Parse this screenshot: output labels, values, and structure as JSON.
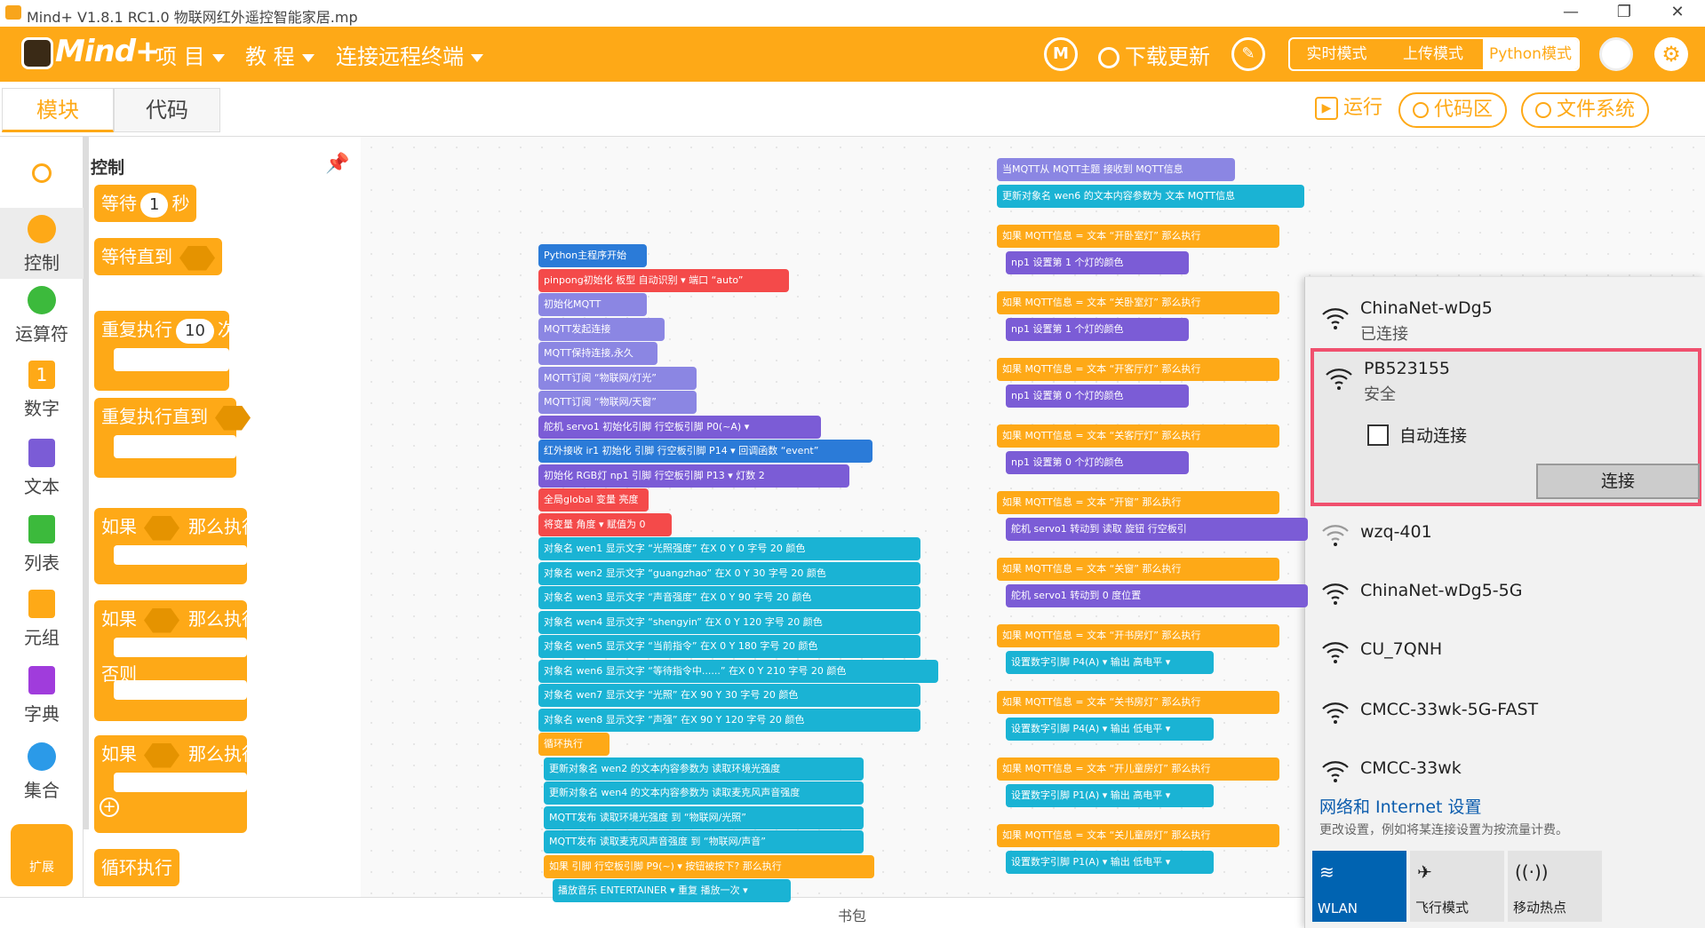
{
  "window": {
    "title": "Mind+ V1.8.1 RC1.0   物联网红外遥控智能家居.mp",
    "min": "—",
    "max": "❐",
    "close": "✕"
  },
  "menu": {
    "logo": "Mind+",
    "items": [
      "项 目",
      "教 程",
      "连接远程终端"
    ],
    "download": "下载更新",
    "modes": [
      "实时模式",
      "上传模式",
      "Python模式"
    ]
  },
  "tabs": {
    "blocks": "模块",
    "code": "代码"
  },
  "actions": {
    "run": "运行",
    "code_area": "代码区",
    "file_system": "文件系统"
  },
  "categories": [
    "控制",
    "运算符",
    "数字",
    "文本",
    "列表",
    "元组",
    "字典",
    "集合"
  ],
  "extension": "扩展",
  "palette": {
    "title": "控制",
    "wait": "等待",
    "wait_val": "1",
    "wait_unit": "秒",
    "wait_until": "等待直到",
    "repeat": "重复执行",
    "repeat_val": "10",
    "repeat_unit": "次",
    "repeat_until": "重复执行直到",
    "if": "如果",
    "then": "那么执行",
    "else": "否则",
    "forever": "循环执行"
  },
  "code": {
    "main": [
      "Python主程序开始",
      "pinpong初始化 板型 自动识别 ▾ 端口 “auto”",
      "初始化MQTT",
      "MQTT发起连接",
      "MQTT保持连接,永久",
      "MQTT订阅 “物联网/灯光”",
      "MQTT订阅 “物联网/天窗”",
      "舵机 servo1 初始化引脚 行空板引脚 P0(~A) ▾",
      "红外接收 ir1 初始化 引脚 行空板引脚 P14 ▾ 回调函数 “event”",
      "初始化 RGB灯 np1 引脚 行空板引脚 P13 ▾ 灯数 2",
      "全局global 变量 亮度",
      "将变量 角度 ▾ 赋值为 0",
      "对象名 wen1 显示文字 “光照强度” 在X 0 Y 0 字号 20 颜色",
      "对象名 wen2 显示文字 “guangzhao” 在X 0 Y 30 字号 20 颜色",
      "对象名 wen3 显示文字 “声音强度” 在X 0 Y 90 字号 20 颜色",
      "对象名 wen4 显示文字 “shengyin” 在X 0 Y 120 字号 20 颜色",
      "对象名 wen5 显示文字 “当前指令” 在X 0 Y 180 字号 20 颜色",
      "对象名 wen6 显示文字 “等待指令中......” 在X 0 Y 210 字号 20 颜色",
      "对象名 wen7 显示文字 “光照” 在X 90 Y 30 字号 20 颜色",
      "对象名 wen8 显示文字 “声强” 在X 90 Y 120 字号 20 颜色",
      "循环执行",
      "更新对象名 wen2 的文本内容参数为 读取环境光强度",
      "更新对象名 wen4 的文本内容参数为 读取麦克风声音强度",
      "MQTT发布 读取环境光强度 到 “物联网/光照”",
      "MQTT发布 读取麦克风声音强度 到 “物联网/声音”",
      "如果 引脚 行空板引脚 P9(~) ▾ 按钮被按下? 那么执行",
      "播放音乐 ENTERTAINER ▾ 重复 播放一次 ▾"
    ],
    "mqtt": [
      "当MQTT从 MQTT主题 接收到 MQTT信息",
      "更新对象名 wen6 的文本内容参数为 文本 MQTT信息",
      "如果 MQTT信息 = 文本 “开卧室灯” 那么执行",
      "np1 设置第 1 个灯的颜色",
      "如果 MQTT信息 = 文本 “关卧室灯” 那么执行",
      "np1 设置第 1 个灯的颜色",
      "如果 MQTT信息 = 文本 “开客厅灯” 那么执行",
      "np1 设置第 0 个灯的颜色",
      "如果 MQTT信息 = 文本 “关客厅灯” 那么执行",
      "np1 设置第 0 个灯的颜色",
      "如果 MQTT信息 = 文本 “开窗” 那么执行",
      "舵机 servo1 转动到 读取 旋钮 行空板引",
      "如果 MQTT信息 = 文本 “关窗” 那么执行",
      "舵机 servo1 转动到 0 度位置",
      "如果 MQTT信息 = 文本 “开书房灯” 那么执行",
      "设置数字引脚 P4(A) ▾ 输出 高电平 ▾",
      "如果 MQTT信息 = 文本 “关书房灯” 那么执行",
      "设置数字引脚 P4(A) ▾ 输出 低电平 ▾",
      "如果 MQTT信息 = 文本 “开儿童房灯” 那么执行",
      "设置数字引脚 P1(A) ▾ 输出 高电平 ▾",
      "如果 MQTT信息 = 文本 “关儿童房灯” 那么执行",
      "设置数字引脚 P1(A) ▾ 输出 低电平 ▾"
    ]
  },
  "backpack": "书包",
  "wifi": {
    "networks": [
      {
        "name": "ChinaNet-wDg5",
        "status": "已连接"
      },
      {
        "name": "PB523155",
        "status": "安全"
      },
      {
        "name": "wzq-401",
        "status": ""
      },
      {
        "name": "ChinaNet-wDg5-5G",
        "status": ""
      },
      {
        "name": "CU_7QNH",
        "status": ""
      },
      {
        "name": "CMCC-33wk-5G-FAST",
        "status": ""
      },
      {
        "name": "CMCC-33wk",
        "status": ""
      }
    ],
    "auto_connect": "自动连接",
    "connect": "连接",
    "settings": "网络和 Internet 设置",
    "settings_sub": "更改设置，例如将某连接设置为按流量计费。",
    "tiles": [
      "WLAN",
      "飞行模式",
      "移动热点"
    ]
  },
  "colors": {
    "orange": "#fea917",
    "cyan": "#1ab3d4",
    "purple": "#7b5cd6",
    "red": "#f44a4a",
    "mqtt": "#8b86e3",
    "blue": "#2b7bd8"
  }
}
